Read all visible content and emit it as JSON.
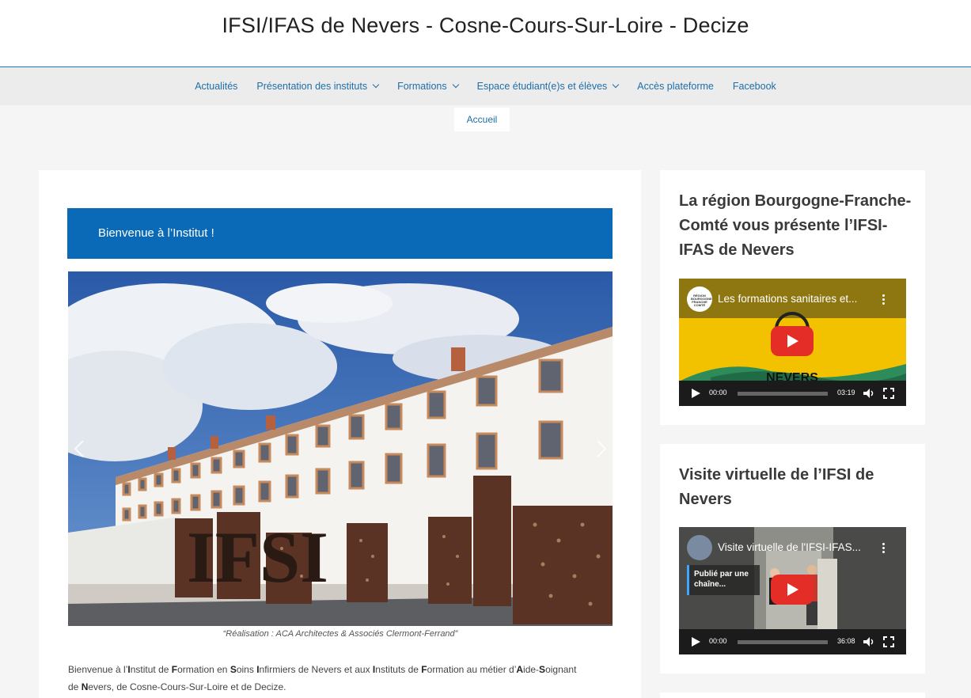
{
  "site": {
    "title": "IFSI/IFAS de Nevers - Cosne-Cours-Sur-Loire - Decize"
  },
  "nav": {
    "items": [
      {
        "label": "Actualités",
        "has_dropdown": false
      },
      {
        "label": "Présentation des instituts",
        "has_dropdown": true
      },
      {
        "label": "Formations",
        "has_dropdown": true
      },
      {
        "label": "Espace étudiant(e)s et élèves",
        "has_dropdown": true
      },
      {
        "label": "Accès plateforme",
        "has_dropdown": false
      },
      {
        "label": "Facebook",
        "has_dropdown": false
      }
    ],
    "breadcrumb": "Accueil"
  },
  "main": {
    "welcome": "Bienvenue à l’Institut !",
    "image_caption": "“Réalisation : ACA Architectes & Associés Clermont-Ferrand”",
    "intro": {
      "line1_a": "Bienvenue à l’",
      "I1": "I",
      "t1": "nstitut de ",
      "F1": "F",
      "t2": "ormation en ",
      "S1": "S",
      "t3": "oins ",
      "I2": "I",
      "t4": "nfirmiers de Nevers et aux ",
      "I3": "I",
      "t5": "nstituts de ",
      "F2": "F",
      "t6": "ormation au métier d’",
      "A1": "A",
      "t7": "ide-",
      "S2": "S",
      "t8": "oignant",
      "line2_a": "de ",
      "N1": "N",
      "t9": "evers, de Cosne-Cours-Sur-Loire et de Decize."
    },
    "building_sign": "IFSI"
  },
  "sidebar": {
    "widget1": {
      "title": "La région Bourgogne-Franche-Comté vous présente l’IFSI-IFAS de Nevers",
      "video": {
        "title": "Les formations sanitaires et...",
        "current_time": "00:00",
        "duration": "03:19",
        "overlay_text": "NEVERS",
        "avatar_text": "RÉGION BOURGOGNE FRANCHE COMTÉ"
      }
    },
    "widget2": {
      "title": "Visite virtuelle de l’IFSI de Nevers",
      "video": {
        "title": "Visite virtuelle de l'IFSI-IFAS...",
        "current_time": "00:00",
        "duration": "36:08",
        "chain_label": "Publié par une chaîne..."
      }
    }
  },
  "colors": {
    "primary_blue": "#0a6ab7",
    "link_blue": "#1e6ea7",
    "youtube_red": "#e52d27",
    "page_bg": "#f5f5f5"
  }
}
